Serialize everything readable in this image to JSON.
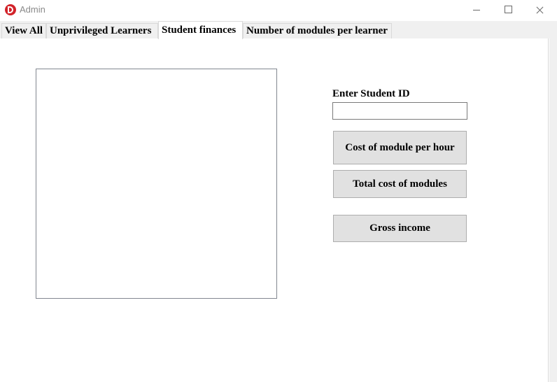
{
  "window": {
    "title": "Admin",
    "icon": "app-logo-icon",
    "accent": "#d2232a"
  },
  "tabs": [
    {
      "label": "View All"
    },
    {
      "label": "Unprivileged Learners"
    },
    {
      "label": "Student finances",
      "active": true
    },
    {
      "label": "Number of modules per learner"
    }
  ],
  "form": {
    "student_id_label": "Enter Student ID",
    "student_id_value": "",
    "cost_per_hour_label": "Cost of module per hour",
    "total_cost_label": "Total cost of modules",
    "gross_income_label": "Gross income"
  }
}
